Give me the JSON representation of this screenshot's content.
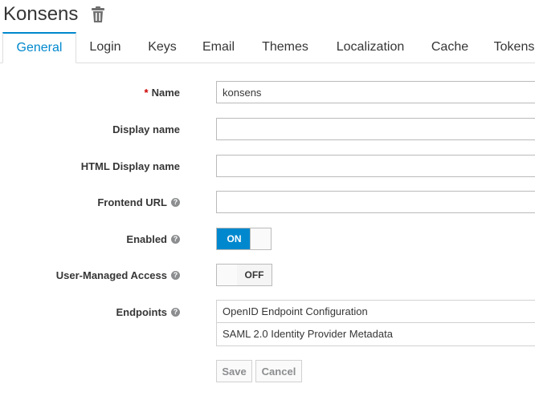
{
  "header": {
    "realm_name": "Konsens"
  },
  "tabs": [
    {
      "label": "General",
      "active": true
    },
    {
      "label": "Login"
    },
    {
      "label": "Keys"
    },
    {
      "label": "Email"
    },
    {
      "label": "Themes"
    },
    {
      "label": "Localization"
    },
    {
      "label": "Cache"
    },
    {
      "label": "Tokens"
    }
  ],
  "form": {
    "name": {
      "label": "Name",
      "required_mark": "*",
      "value": "konsens"
    },
    "display_name": {
      "label": "Display name",
      "value": ""
    },
    "html_display_name": {
      "label": "HTML Display name",
      "value": ""
    },
    "frontend_url": {
      "label": "Frontend URL",
      "value": ""
    },
    "enabled": {
      "label": "Enabled",
      "state_label": "ON",
      "checked": true
    },
    "user_managed_access": {
      "label": "User-Managed Access",
      "state_label": "OFF",
      "checked": false
    },
    "endpoints": {
      "label": "Endpoints",
      "links": [
        "OpenID Endpoint Configuration",
        "SAML 2.0 Identity Provider Metadata"
      ]
    }
  },
  "help_icon_glyph": "?",
  "buttons": {
    "save": "Save",
    "cancel": "Cancel"
  },
  "colors": {
    "accent": "#0088ce",
    "required": "#cc0000"
  },
  "icons": {
    "delete": "trash-icon",
    "help": "question-circle-icon"
  }
}
